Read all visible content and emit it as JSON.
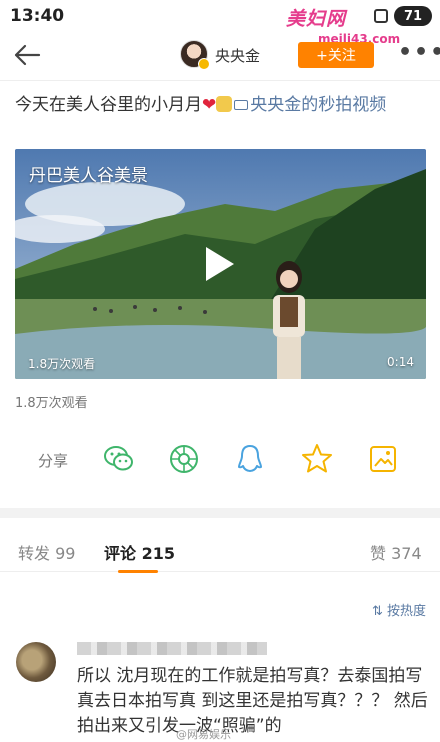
{
  "status_bar": {
    "time": "13:40",
    "battery": "71"
  },
  "watermark": {
    "logo": "美妇网",
    "url": "meili43.com"
  },
  "nav": {
    "username": "央央金",
    "follow_label": "+关注",
    "more_label": "•••"
  },
  "post": {
    "text_main": "今天在美人谷里的小月月",
    "heart": "❤",
    "link_text": "央央金的秒拍视频"
  },
  "video": {
    "title": "丹巴美人谷美景",
    "view_count": "1.8万次观看",
    "duration": "0:14"
  },
  "views_below": "1.8万次观看",
  "share": {
    "label": "分享",
    "icons": [
      "wechat-icon",
      "moments-icon",
      "qq-icon",
      "qzone-icon",
      "save-image-icon"
    ]
  },
  "tabs": {
    "repost_label": "转发",
    "repost_count": "99",
    "comment_label": "评论",
    "comment_count": "215",
    "like_label": "赞",
    "like_count": "374"
  },
  "sort_label": "按热度",
  "comment": {
    "text": "所以 沈月现在的工作就是拍写真？去泰国拍写真去日本拍写真 到这里还是拍写真？？？ 然后拍出来又引发一波“照骗”的"
  },
  "bottom_watermark": "@网易娱乐",
  "colors": {
    "accent": "#ff8200",
    "link": "#5a7aa3",
    "share_green": "#3fb56b",
    "share_blue": "#4aa3df",
    "share_yellow": "#f5b400"
  }
}
